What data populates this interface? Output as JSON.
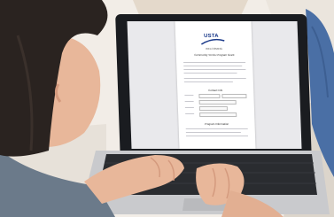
{
  "screen_document": {
    "logo_text": "USTA",
    "header_label": "WELCOMING",
    "title": "Community Tennis Program Grant",
    "section_contact": "Contact Info",
    "section_program": "Program Information"
  },
  "colors": {
    "usta_blue": "#1b3a8a",
    "hair": "#2a2320",
    "skin": "#e8b79a",
    "laptop": "#1a1c20",
    "keys": "#2a2c30",
    "jeans": "#4a6fa5"
  }
}
